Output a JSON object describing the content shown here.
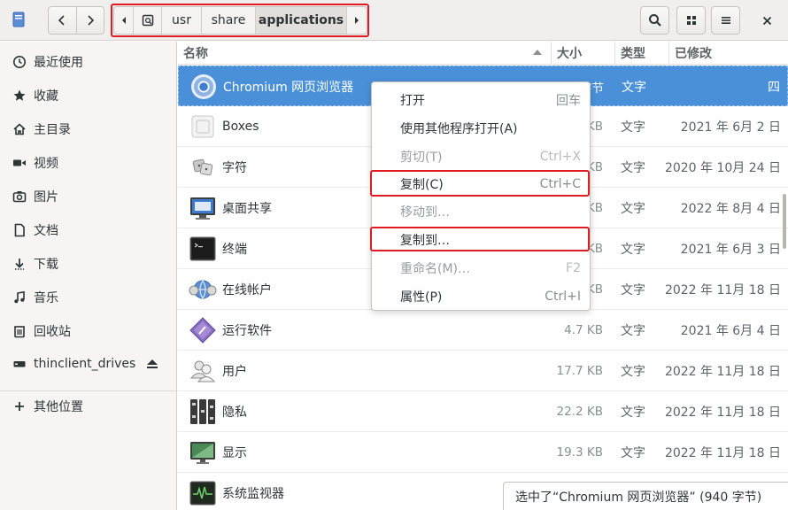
{
  "pathbar": {
    "segments": [
      "usr",
      "share",
      "applications"
    ]
  },
  "sidebar": {
    "items": [
      {
        "label": "最近使用",
        "icon": "clock-icon"
      },
      {
        "label": "收藏",
        "icon": "star-icon"
      },
      {
        "label": "主目录",
        "icon": "home-icon"
      },
      {
        "label": "视频",
        "icon": "video-icon"
      },
      {
        "label": "图片",
        "icon": "camera-icon"
      },
      {
        "label": "文档",
        "icon": "document-icon"
      },
      {
        "label": "下载",
        "icon": "download-icon"
      },
      {
        "label": "音乐",
        "icon": "music-icon"
      },
      {
        "label": "回收站",
        "icon": "trash-icon"
      },
      {
        "label": "thinclient_drives",
        "icon": "drive-icon"
      },
      {
        "label": "其他位置",
        "icon": "plus-icon"
      }
    ]
  },
  "columns": {
    "name": "名称",
    "size": "大小",
    "type": "类型",
    "modified": "已修改"
  },
  "files": [
    {
      "name": "Chromium 网页浏览器",
      "size": "940 字节",
      "type": "文字",
      "date": "四",
      "selected": true,
      "icon": "chromium-icon"
    },
    {
      "name": "Boxes",
      "size": "KB",
      "type": "文字",
      "date": "2021 年 6月  2 日",
      "icon": "boxes-icon"
    },
    {
      "name": "字符",
      "size": "KB",
      "type": "文字",
      "date": "2020 年 10月 24 日",
      "icon": "characters-icon"
    },
    {
      "name": "桌面共享",
      "size": "KB",
      "type": "文字",
      "date": "2022 年 8月  4 日",
      "icon": "desktop-sharing-icon"
    },
    {
      "name": "终端",
      "size": "KB",
      "type": "文字",
      "date": "2021 年 6月  3 日",
      "icon": "terminal-icon"
    },
    {
      "name": "在线帐户",
      "size": "KB",
      "type": "文字",
      "date": "2022 年 11月 18 日",
      "icon": "online-accounts-icon"
    },
    {
      "name": "运行软件",
      "size": "4.7 KB",
      "type": "文字",
      "date": "2021 年 6月  4 日",
      "icon": "run-software-icon"
    },
    {
      "name": "用户",
      "size": "17.7 KB",
      "type": "文字",
      "date": "2022 年 11月 18 日",
      "icon": "users-icon"
    },
    {
      "name": "隐私",
      "size": "22.2 KB",
      "type": "文字",
      "date": "2022 年 11月 18 日",
      "icon": "privacy-icon"
    },
    {
      "name": "显示",
      "size": "19.3 KB",
      "type": "文字",
      "date": "2022 年 11月 18 日",
      "icon": "display-icon"
    },
    {
      "name": "系统监视器",
      "size": "",
      "type": "",
      "date": "",
      "icon": "system-monitor-icon"
    }
  ],
  "context_menu": {
    "items": [
      {
        "label": "打开",
        "accel": "回车",
        "disabled": false
      },
      {
        "label": "使用其他程序打开(A)",
        "accel": "",
        "disabled": false
      },
      {
        "label": "剪切(T)",
        "accel": "Ctrl+X",
        "disabled": true
      },
      {
        "label": "复制(C)",
        "accel": "Ctrl+C",
        "disabled": false
      },
      {
        "label": "移动到…",
        "accel": "",
        "disabled": true
      },
      {
        "label": "复制到…",
        "accel": "",
        "disabled": false
      },
      {
        "label": "重命名(M)…",
        "accel": "F2",
        "disabled": true
      },
      {
        "label": "属性(P)",
        "accel": "Ctrl+I",
        "disabled": false
      }
    ]
  },
  "status": {
    "text": "选中了“Chromium 网页浏览器” (940 字节)"
  },
  "colors": {
    "selection": "#4a90d9",
    "highlight": "#e01b24",
    "headerbar": "#f0efee"
  }
}
